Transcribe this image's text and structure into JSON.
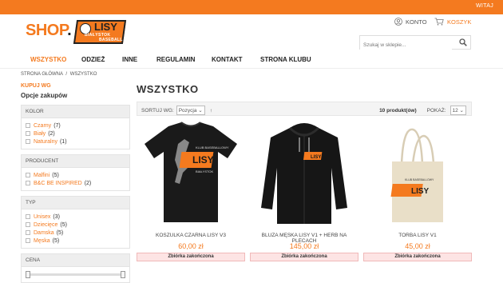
{
  "topbar": {
    "greeting": "WITAJ"
  },
  "logo": {
    "shop": "SHOP",
    "dot": ".",
    "lisy": "LISY",
    "sub1": "BIAŁYSTOK",
    "sub2": "BASEBALL"
  },
  "header": {
    "account_label": "KONTO",
    "cart_label": "KOSZYK",
    "search_placeholder": "Szukaj w sklepie..."
  },
  "nav": {
    "items": [
      "WSZYSTKO",
      "ODZIEŻ",
      "INNE",
      "REGULAMIN",
      "KONTAKT",
      "STRONA KLUBU"
    ],
    "active": "WSZYSTKO"
  },
  "breadcrumb": {
    "home": "STRONA GŁÓWNA",
    "sep": "/",
    "current": "WSZYSTKO"
  },
  "sidebar": {
    "heading": "KUPUJ WG",
    "subheading": "Opcje zakupów",
    "filters": [
      {
        "title": "KOLOR",
        "options": [
          {
            "label": "Czarny",
            "count": "(7)"
          },
          {
            "label": "Biały",
            "count": "(2)"
          },
          {
            "label": "Naturalny",
            "count": "(1)"
          }
        ]
      },
      {
        "title": "PRODUCENT",
        "options": [
          {
            "label": "Malfini",
            "count": "(5)"
          },
          {
            "label": "B&C BE INSPIRED",
            "count": "(2)"
          }
        ]
      },
      {
        "title": "TYP",
        "options": [
          {
            "label": "Unisex",
            "count": "(3)"
          },
          {
            "label": "Dziecięce",
            "count": "(5)"
          },
          {
            "label": "Damska",
            "count": "(5)"
          },
          {
            "label": "Męska",
            "count": "(5)"
          }
        ]
      },
      {
        "title": "CENA",
        "options": []
      }
    ]
  },
  "main": {
    "title": "WSZYSTKO",
    "sort_label": "SORTUJ WG:",
    "sort_value": "Pozycja",
    "sort_dir": "↑",
    "product_count": "10 produkt(ów)",
    "show_label": "POKAŻ:",
    "show_value": "12"
  },
  "products": [
    {
      "name": "KOSZULKA CZARNA LISY V3",
      "price": "60,00 zł",
      "status": "Zbiórka zakończona"
    },
    {
      "name": "BLUZA MĘSKA LISY V1 + HERB NA PLECACH",
      "price": "145,00 zł",
      "status": "Zbiórka zakończona"
    },
    {
      "name": "TORBA LISY V1",
      "price": "45,00 zł",
      "status": "Zbiórka zakończona"
    }
  ],
  "product_logo": {
    "line1": "KLUB BASEBALLOWY",
    "lisy": "LISY",
    "line2": "BIAŁYSTOK",
    "est": "est. 2017"
  },
  "colors": {
    "accent": "#f47a1f",
    "status_bg": "#fde4e4"
  }
}
